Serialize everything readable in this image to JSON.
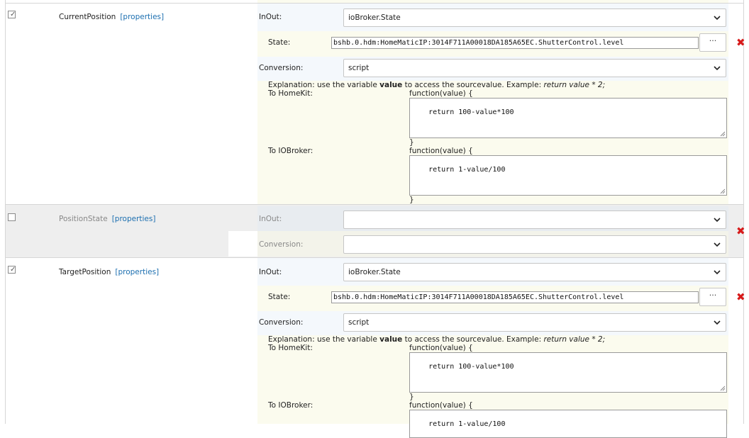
{
  "properties_link": "[properties]",
  "labels": {
    "inout": "InOut:",
    "state": "State:",
    "conversion": "Conversion:",
    "to_homekit": "To HomeKit:",
    "to_iobroker": "To IOBroker:",
    "fn_open": "function(value) {",
    "fn_close": "}",
    "browse_button": "···"
  },
  "explanation": {
    "prefix": "Explanation: use the variable ",
    "bold": "value",
    "middle": " to access the sourcevalue. Example: ",
    "example": "return value * 2;"
  },
  "characteristics": [
    {
      "name": "CurrentPosition",
      "enabled": true,
      "inout": "ioBroker.State",
      "state": "bshb.0.hdm:HomeMaticIP:3014F711A00018DA185A65EC.ShutterControl.level",
      "conversion": "script",
      "to_homekit_code": "return 100-value*100",
      "to_iobroker_code": "return 1-value/100"
    },
    {
      "name": "PositionState",
      "enabled": false,
      "inout": "",
      "conversion": ""
    },
    {
      "name": "TargetPosition",
      "enabled": true,
      "inout": "ioBroker.State",
      "state": "bshb.0.hdm:HomeMaticIP:3014F711A00018DA185A65EC.ShutterControl.level",
      "conversion": "script",
      "to_homekit_code": "return 100-value*100",
      "to_iobroker_code": "return 1-value/100"
    }
  ],
  "colors": {
    "highlight_band": "#fbfbee",
    "inout_band": "#f4f8fc",
    "disabled_row": "#eeeeee",
    "link": "#1c6fb0",
    "delete": "#d71a1a"
  }
}
